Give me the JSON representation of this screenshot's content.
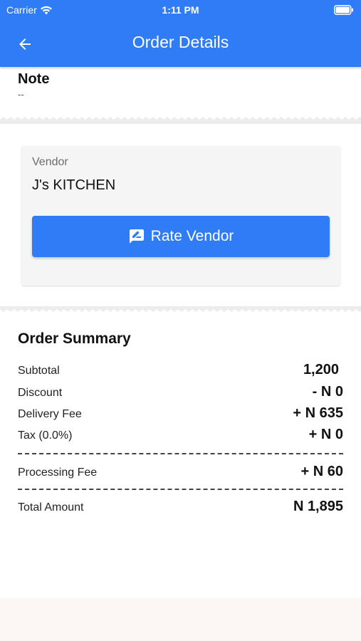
{
  "status_bar": {
    "carrier": "Carrier",
    "time": "1:11 PM"
  },
  "app_bar": {
    "title": "Order Details",
    "back_icon": "arrow-left-icon"
  },
  "note": {
    "title": "Note",
    "value": "--"
  },
  "vendor": {
    "label": "Vendor",
    "name": "J's KITCHEN",
    "rate_button_label": "Rate Vendor",
    "rate_icon": "rate-review-icon"
  },
  "summary": {
    "title": "Order Summary",
    "rows": [
      {
        "label": "Subtotal",
        "value": "1,200"
      },
      {
        "label": "Discount",
        "value": "- N 0"
      },
      {
        "label": "Delivery Fee",
        "value": "+ N 635"
      },
      {
        "label": "Tax (0.0%)",
        "value": "+ N 0"
      },
      {
        "label": "Processing Fee",
        "value": "+ N 60"
      },
      {
        "label": "Total Amount",
        "value": "N 1,895"
      }
    ]
  },
  "colors": {
    "primary": "#2f7cf6",
    "card": "#f5f5f5",
    "footer": "#fcf7f4"
  }
}
